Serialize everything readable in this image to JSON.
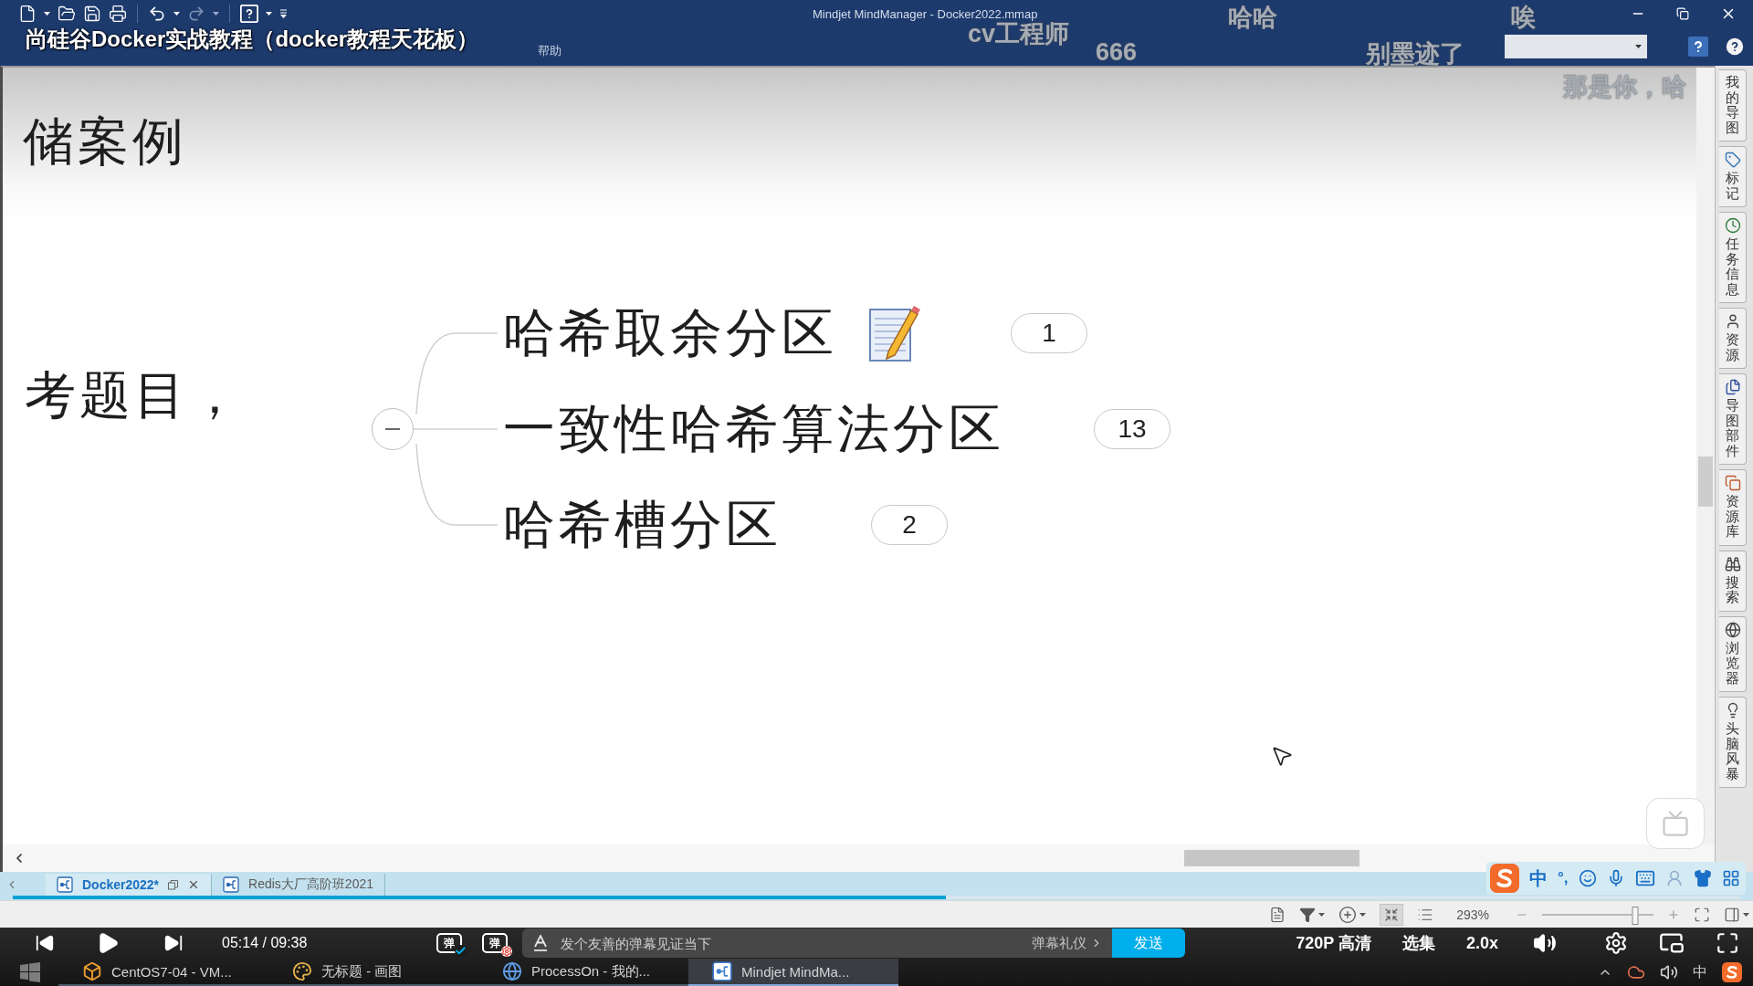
{
  "video": {
    "title": "尚硅谷Docker实战教程（docker教程天花板）"
  },
  "window": {
    "title": "Mindjet MindManager - Docker2022.mmap"
  },
  "ribbon": {
    "tabs": [
      {
        "label": "帮助",
        "selected": false
      }
    ]
  },
  "danmaku": [
    "cv工程师",
    "哈哈",
    "唉",
    "666",
    "别墨迹了",
    "那是你，哈"
  ],
  "canvas": {
    "cut_topics": [
      "储案例",
      "考题目，"
    ],
    "map": {
      "expanded": true,
      "topics": [
        {
          "label": "哈希取余分区",
          "note": true,
          "count": "1"
        },
        {
          "label": "一致性哈希算法分区",
          "note": false,
          "count": "13"
        },
        {
          "label": "哈希槽分区",
          "note": false,
          "count": "2"
        }
      ]
    }
  },
  "sidebar": {
    "tabs": [
      {
        "label": "我的导图",
        "kind": "map",
        "selected": false
      },
      {
        "label": "标记",
        "kind": "markers",
        "selected": false
      },
      {
        "label": "任务信息",
        "kind": "task",
        "selected": false
      },
      {
        "label": "资源",
        "kind": "resources",
        "selected": false
      },
      {
        "label": "导图部件",
        "kind": "parts",
        "selected": false
      },
      {
        "label": "资源库",
        "kind": "library",
        "selected": false
      },
      {
        "label": "搜索",
        "kind": "search",
        "selected": false
      },
      {
        "label": "浏览器",
        "kind": "browser",
        "selected": false
      },
      {
        "label": "头脑风暴",
        "kind": "brainstorm",
        "selected": false
      }
    ]
  },
  "document_tabs": [
    {
      "label": "Docker2022*",
      "selected": true
    },
    {
      "label": "Redis大厂高阶班2021",
      "selected": false
    }
  ],
  "ime_bar": {
    "mode": "中",
    "punctuation": "°,"
  },
  "status_bar": {
    "zoom": "293%",
    "zoom_slider": {
      "level": 0.84
    }
  },
  "player": {
    "progress": {
      "level": 0.54
    },
    "time": "05:14 / 09:38",
    "danmaku_toggle": {
      "label": "弹",
      "on": true
    },
    "danmaku_settings": {
      "label": "弹"
    },
    "danmaku_input": {
      "placeholder": "发个友善的弹幕见证当下"
    },
    "etiquette": "弹幕礼仪",
    "send": "发送",
    "quality": "720P 高清",
    "episodes": "选集",
    "speed": "2.0x"
  },
  "taskbar": {
    "apps": [
      {
        "label": "CentOS7-04 - VM...",
        "kind": "vm",
        "selected": false
      },
      {
        "label": "无标题 - 画图",
        "kind": "paint",
        "selected": false
      },
      {
        "label": "ProcessOn - 我的...",
        "kind": "browser",
        "selected": false
      },
      {
        "label": "Mindjet MindMa...",
        "kind": "mindmap",
        "selected": true
      }
    ],
    "ime": "中"
  }
}
